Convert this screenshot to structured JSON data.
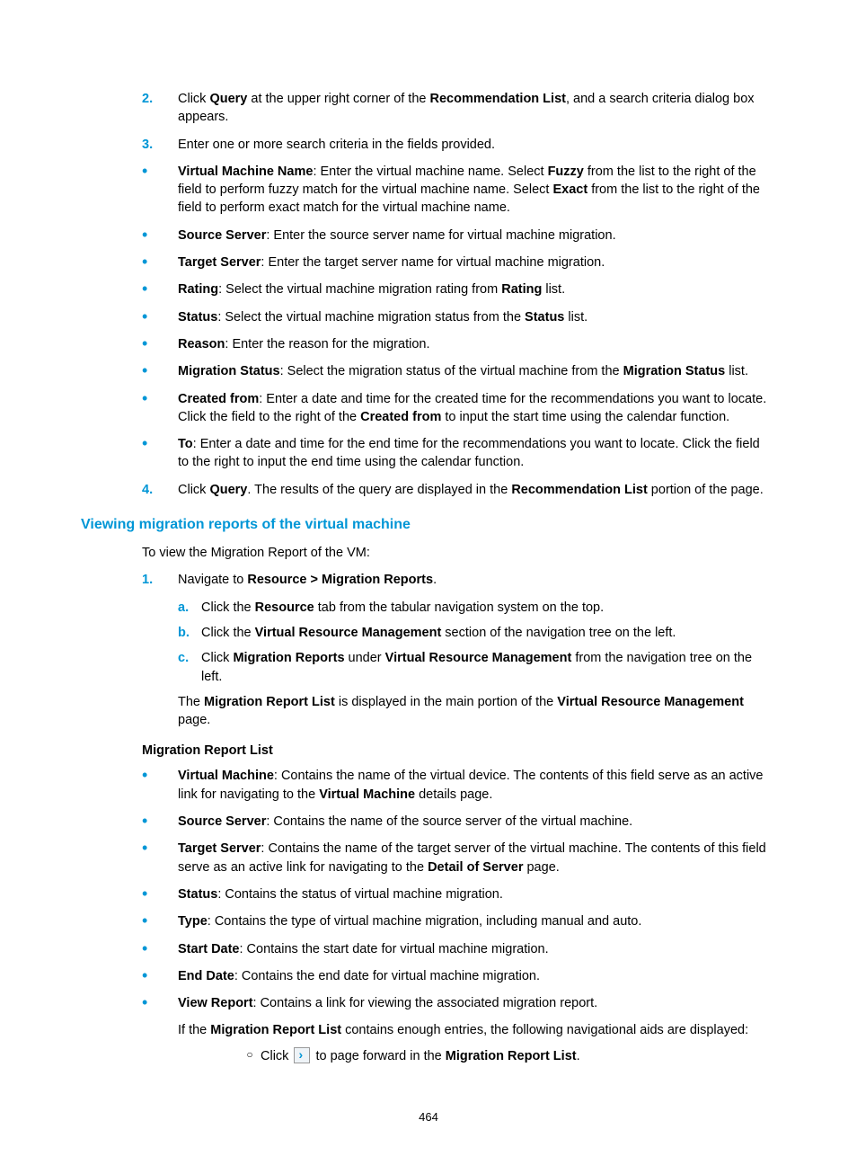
{
  "pageNumber": "464",
  "section": {
    "title": "Viewing migration reports of the virtual machine",
    "intro": "To view the Migration Report of the VM:"
  },
  "topList": {
    "i2": {
      "marker": "2.",
      "pre": "Click ",
      "b1": "Query",
      "mid": " at the upper right corner of the ",
      "b2": "Recommendation List",
      "post": ", and a search criteria dialog box appears."
    },
    "i3": {
      "marker": "3.",
      "text": "Enter one or more search criteria in the fields provided."
    },
    "b_vm": {
      "label": "Virtual Machine Name",
      "pre": ": Enter the virtual machine name. Select ",
      "b1": "Fuzzy",
      "mid": " from the list to the right of the field to perform fuzzy match for the virtual machine name. Select ",
      "b2": "Exact",
      "post": " from the list to the right of the field to perform exact match for the virtual machine name."
    },
    "b_src": {
      "label": "Source Server",
      "text": ": Enter the source server name for virtual machine migration."
    },
    "b_tgt": {
      "label": "Target Server",
      "text": ": Enter the target server name for virtual machine migration."
    },
    "b_rat": {
      "label": "Rating",
      "pre": ": Select the virtual machine migration rating from ",
      "b1": "Rating",
      "post": " list."
    },
    "b_stat": {
      "label": "Status",
      "pre": ": Select the virtual machine migration status from the ",
      "b1": "Status",
      "post": " list."
    },
    "b_rsn": {
      "label": "Reason",
      "text": ": Enter the reason for the migration."
    },
    "b_mstat": {
      "label": "Migration Status",
      "pre": ": Select the migration status of the virtual machine from the ",
      "b1": "Migration Status",
      "post": " list."
    },
    "b_cfrom": {
      "label": "Created from",
      "pre": ": Enter a date and time for the created time for the recommendations you want to locate. Click the field to the right of the ",
      "b1": "Created from",
      "post": " to input the start time using the calendar function."
    },
    "b_to": {
      "label": "To",
      "text": ": Enter a date and time for the end time for the recommendations you want to locate. Click the field to the right to input the end time using the calendar function."
    },
    "i4": {
      "marker": "4.",
      "pre": "Click ",
      "b1": "Query",
      "mid": ". The results of the query are displayed in the ",
      "b2": "Recommendation List",
      "post": " portion of the page."
    }
  },
  "navList": {
    "i1": {
      "marker": "1.",
      "pre": "Navigate to ",
      "b1": "Resource > Migration Reports",
      "post": "."
    },
    "a": {
      "marker": "a.",
      "pre": "Click the ",
      "b1": "Resource",
      "post": " tab from the tabular navigation system on the top."
    },
    "b": {
      "marker": "b.",
      "pre": "Click the ",
      "b1": "Virtual Resource Management",
      "post": " section of the navigation tree on the left."
    },
    "c": {
      "marker": "c.",
      "pre": "Click ",
      "b1": "Migration Reports",
      "mid": " under ",
      "b2": "Virtual Resource Management",
      "post": " from the navigation tree on the left."
    },
    "result": {
      "pre": "The ",
      "b1": "Migration Report List",
      "mid": " is displayed in the main portion of the ",
      "b2": "Virtual Resource Management",
      "post": " page."
    }
  },
  "mrl": {
    "heading": "Migration Report List",
    "vm": {
      "label": "Virtual Machine",
      "pre": ": Contains the name of the virtual device. The contents of this field serve as an active link for navigating to the ",
      "b1": "Virtual Machine",
      "post": " details page."
    },
    "src": {
      "label": "Source Server",
      "text": ": Contains the name of the source server of the virtual machine."
    },
    "tgt": {
      "label": "Target Server",
      "pre": ": Contains the name of the target server of the virtual machine. The contents of this field serve as an active link for navigating to the ",
      "b1": "Detail of Server",
      "post": " page."
    },
    "stat": {
      "label": "Status",
      "text": ": Contains the status of virtual machine migration."
    },
    "type": {
      "label": "Type",
      "text": ": Contains the type of virtual machine migration, including manual and auto."
    },
    "sdate": {
      "label": "Start Date",
      "text": ": Contains the start date for virtual machine migration."
    },
    "edate": {
      "label": "End Date",
      "text": ": Contains the end date for virtual machine migration."
    },
    "view": {
      "label": "View Report",
      "text": ": Contains a link for viewing the associated migration report."
    },
    "navaid": {
      "pre": "If the ",
      "b1": "Migration Report List",
      "post": " contains enough entries, the following navigational aids are displayed:"
    },
    "circ1": {
      "pre": "Click ",
      "mid": " to page forward in the ",
      "b1": "Migration Report List",
      "post": "."
    }
  }
}
